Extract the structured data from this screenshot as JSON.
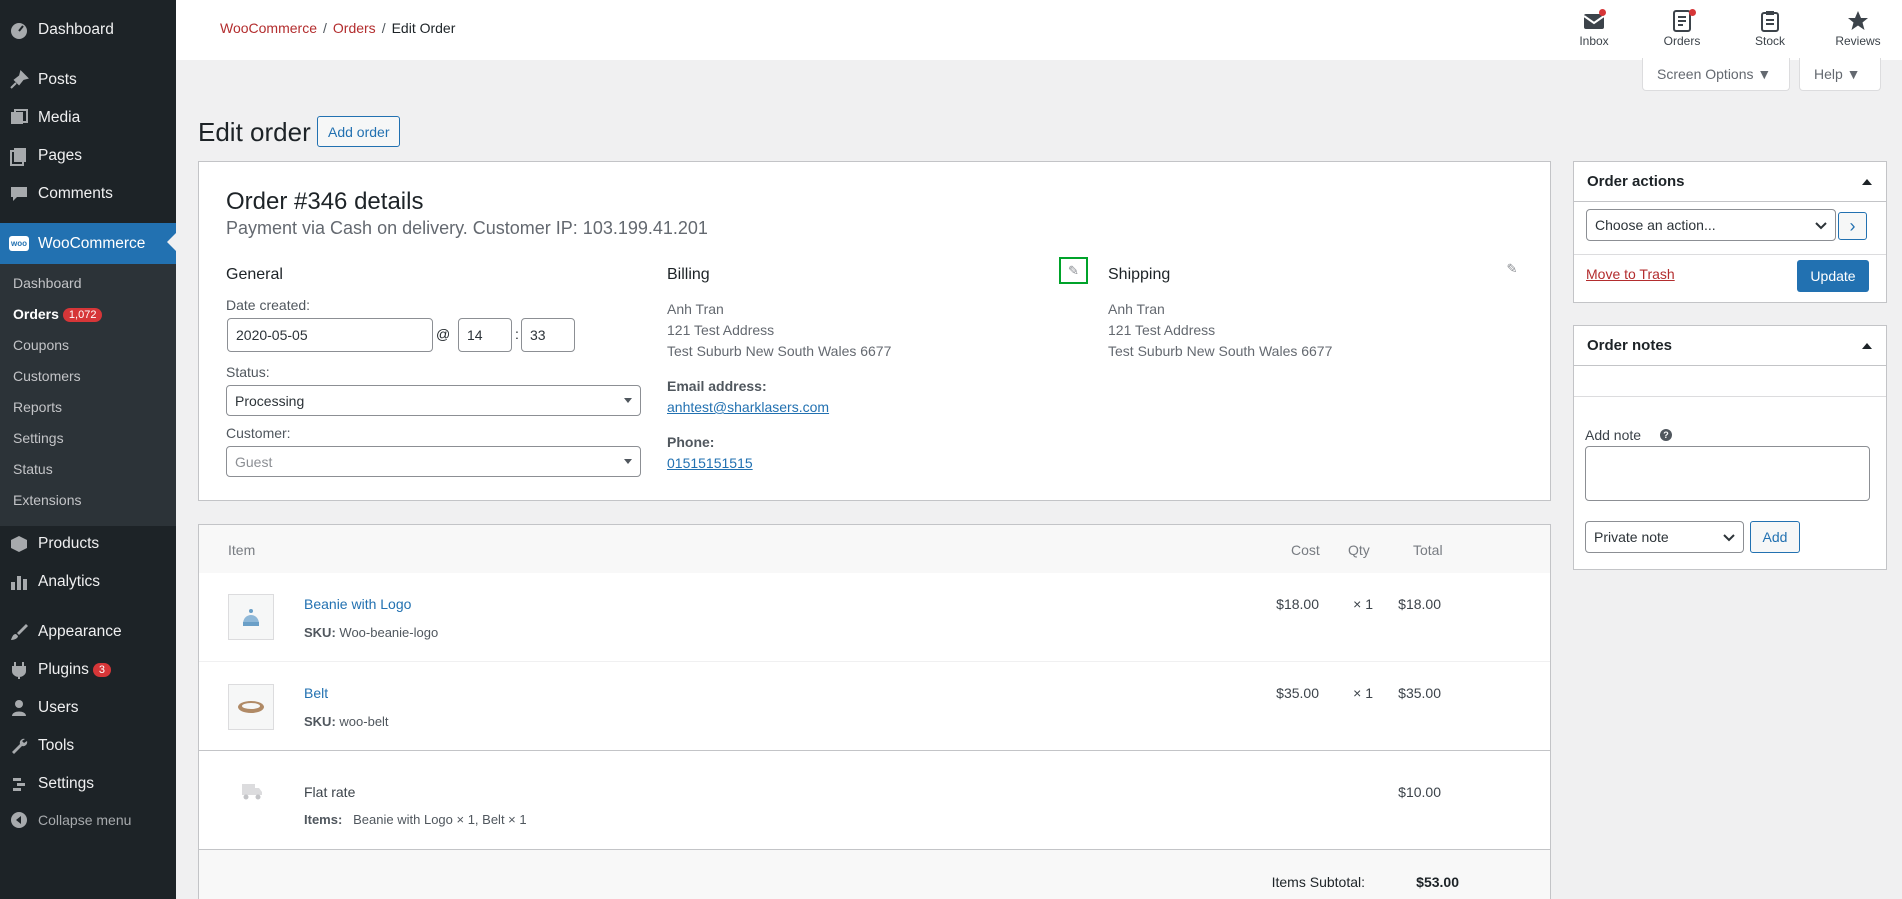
{
  "sidebar": {
    "top_items": [
      {
        "label": "Dashboard",
        "icon": "dashboard-icon"
      },
      {
        "label": "Posts",
        "icon": "pin-icon"
      },
      {
        "label": "Media",
        "icon": "media-icon"
      },
      {
        "label": "Pages",
        "icon": "pages-icon"
      },
      {
        "label": "Comments",
        "icon": "comments-icon"
      }
    ],
    "woocommerce": {
      "label": "WooCommerce",
      "icon": "woo-icon",
      "icon_text": "woo"
    },
    "submenu": [
      {
        "label": "Dashboard"
      },
      {
        "label": "Orders",
        "badge": "1,072"
      },
      {
        "label": "Coupons"
      },
      {
        "label": "Customers"
      },
      {
        "label": "Reports"
      },
      {
        "label": "Settings"
      },
      {
        "label": "Status"
      },
      {
        "label": "Extensions"
      }
    ],
    "bottom_items": [
      {
        "label": "Products",
        "icon": "products-icon"
      },
      {
        "label": "Analytics",
        "icon": "analytics-icon"
      },
      {
        "label": "Appearance",
        "icon": "appearance-icon"
      },
      {
        "label": "Plugins",
        "icon": "plugins-icon",
        "badge": "3"
      },
      {
        "label": "Users",
        "icon": "users-icon"
      },
      {
        "label": "Tools",
        "icon": "tools-icon"
      },
      {
        "label": "Settings",
        "icon": "settings-icon"
      },
      {
        "label": "Collapse menu",
        "icon": "collapse-icon"
      }
    ]
  },
  "breadcrumb": {
    "woocommerce": "WooCommerce",
    "orders": "Orders",
    "sep": "/",
    "current": "Edit Order"
  },
  "topbar": {
    "inbox": "Inbox",
    "orders": "Orders",
    "stock": "Stock",
    "reviews": "Reviews"
  },
  "screen_options": {
    "screen": "Screen Options ▼",
    "help": "Help ▼"
  },
  "page": {
    "title": "Edit order",
    "add_order": "Add order"
  },
  "order": {
    "title": "Order #346 details",
    "subtitle": "Payment via Cash on delivery. Customer IP: 103.199.41.201",
    "general": {
      "heading": "General",
      "date_label": "Date created:",
      "date": "2020-05-05",
      "at": "@",
      "hour": "14",
      "colon": ":",
      "minute": "33",
      "status_label": "Status:",
      "status": "Processing",
      "customer_label": "Customer:",
      "customer": "Guest"
    },
    "billing": {
      "heading": "Billing",
      "name": "Anh Tran",
      "address1": "121 Test Address",
      "address2": "Test Suburb New South Wales 6677",
      "email_label": "Email address:",
      "email": "anhtest@sharklasers.com",
      "phone_label": "Phone:",
      "phone": "01515151515"
    },
    "shipping": {
      "heading": "Shipping",
      "name": "Anh Tran",
      "address1": "121 Test Address",
      "address2": "Test Suburb New South Wales 6677"
    }
  },
  "items": {
    "headers": {
      "item": "Item",
      "cost": "Cost",
      "qty": "Qty",
      "total": "Total"
    },
    "rows": [
      {
        "name": "Beanie with Logo",
        "sku_label": "SKU:",
        "sku": "Woo-beanie-logo",
        "cost": "$18.00",
        "qty": "× 1",
        "total": "$18.00"
      },
      {
        "name": "Belt",
        "sku_label": "SKU:",
        "sku": "woo-belt",
        "cost": "$35.00",
        "qty": "× 1",
        "total": "$35.00"
      }
    ],
    "shipping": {
      "name": "Flat rate",
      "items_label": "Items:",
      "items": "Beanie with Logo × 1, Belt × 1",
      "total": "$10.00"
    },
    "subtotal_label": "Items Subtotal:",
    "subtotal": "$53.00"
  },
  "order_actions": {
    "heading": "Order actions",
    "select": "Choose an action...",
    "go": "›",
    "trash": "Move to Trash",
    "update": "Update"
  },
  "order_notes": {
    "heading": "Order notes",
    "add_note_label": "Add note",
    "help": "?",
    "note_type": "Private note",
    "add": "Add"
  },
  "colors": {
    "sidebar": "#1d2327",
    "accent": "#2271b1",
    "badge": "#d63638",
    "highlight": "#00a32a"
  }
}
